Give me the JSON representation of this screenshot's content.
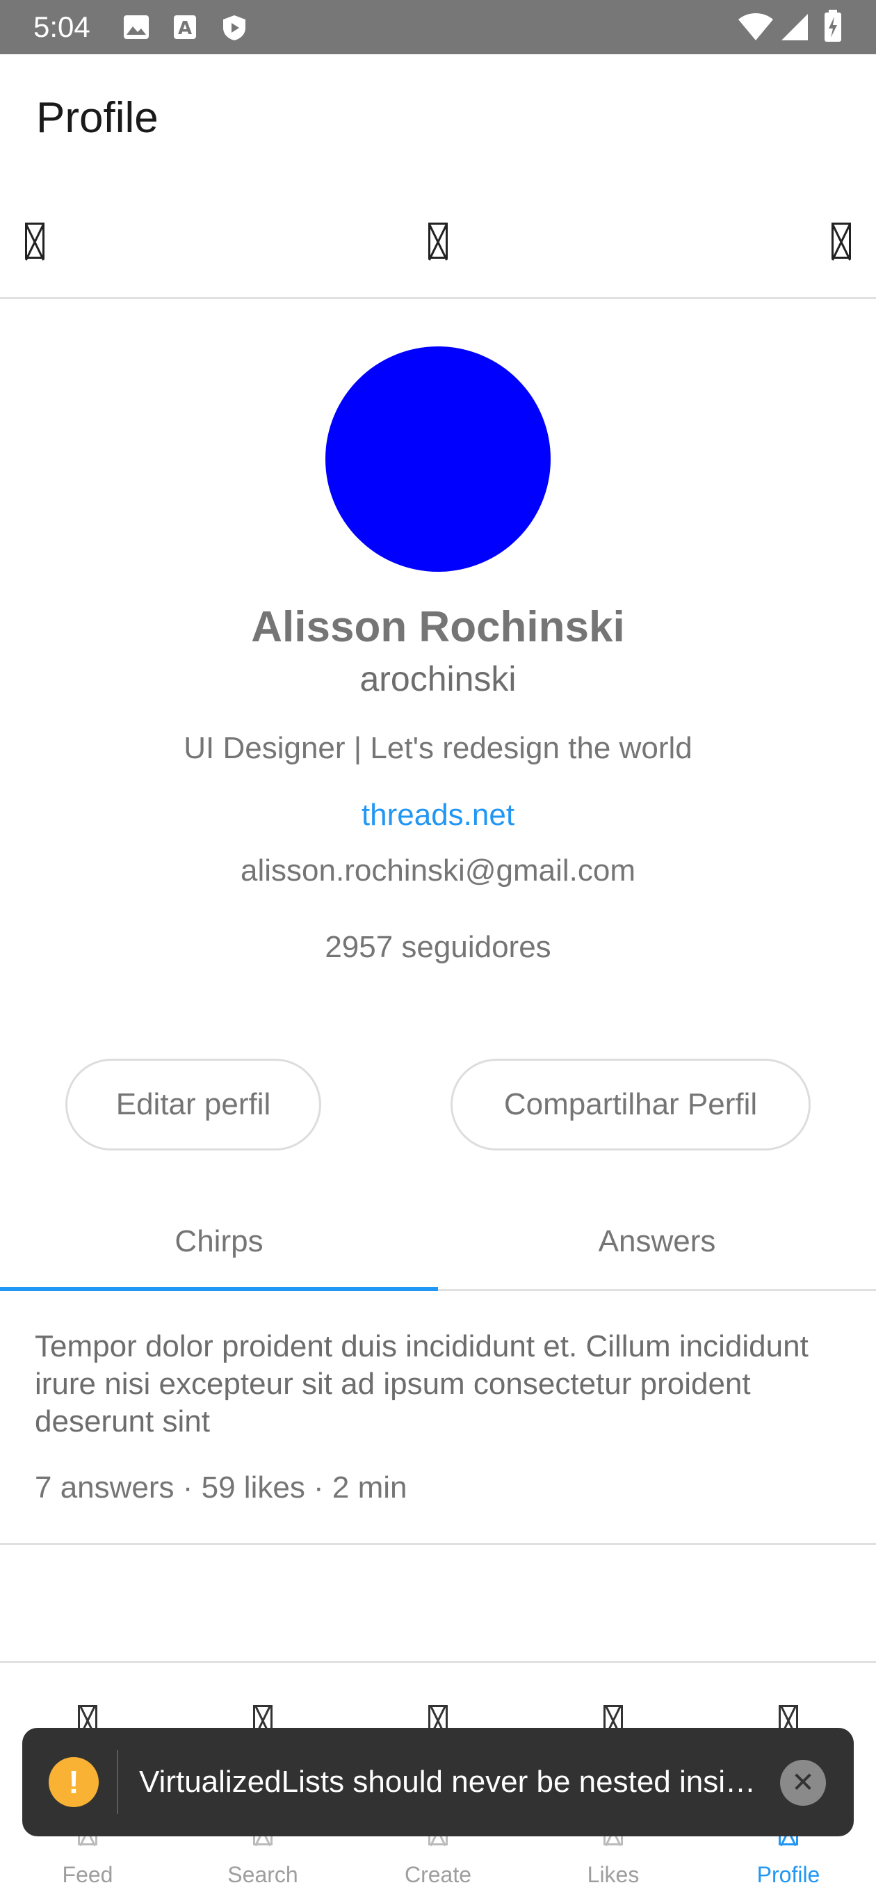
{
  "status_bar": {
    "time": "5:04",
    "left_icons": [
      "image-icon",
      "a-box-icon",
      "shield-play-icon"
    ],
    "right_icons": [
      "wifi-icon",
      "signal-icon",
      "battery-charging-icon"
    ]
  },
  "header": {
    "title": "Profile"
  },
  "top_row": {
    "icons": [
      "missing-glyph-icon",
      "missing-glyph-icon",
      "missing-glyph-icon"
    ]
  },
  "profile": {
    "avatar_color": "#0000ff",
    "name": "Alisson Rochinski",
    "username": "arochinski",
    "bio": "UI Designer | Let's redesign the world",
    "link": "threads.net",
    "email": "alisson.rochinski@gmail.com",
    "followers": "2957 seguidores"
  },
  "actions": {
    "edit_label": "Editar perfil",
    "share_label": "Compartilhar Perfil"
  },
  "tabs": [
    {
      "label": "Chirps",
      "active": true
    },
    {
      "label": "Answers",
      "active": false
    }
  ],
  "posts": [
    {
      "text": "Tempor dolor proident duis incididunt et. Cillum incididunt irure nisi excepteur sit ad ipsum consectetur proident deserunt sint",
      "meta": "7 answers · 59 likes · 2 min"
    }
  ],
  "bottom_nav": [
    {
      "label": "Feed",
      "active": false
    },
    {
      "label": "Search",
      "active": false
    },
    {
      "label": "Create",
      "active": false
    },
    {
      "label": "Likes",
      "active": false
    },
    {
      "label": "Profile",
      "active": true
    }
  ],
  "toast": {
    "icon": "warning-icon",
    "message": "VirtualizedLists should never be nested insi…",
    "close_icon": "close-icon"
  },
  "colors": {
    "accent": "#2196f3",
    "status_bar": "#777777",
    "toast_bg": "#323232",
    "warning": "#f9b233"
  }
}
